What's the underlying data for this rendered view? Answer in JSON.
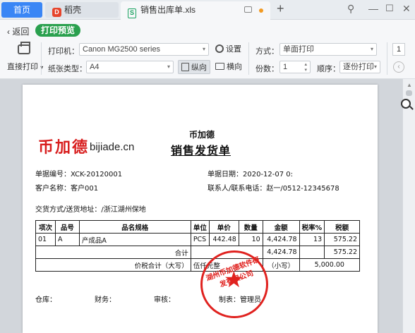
{
  "titlebar": {
    "tab_home": "首页",
    "tab_wps": "稻壳",
    "tab_file": "销售出库单.xls",
    "window_controls": [
      "minimize-icon",
      "maximize-icon",
      "close-icon"
    ]
  },
  "toolbar": {
    "back_label": "返回",
    "mode_label": "打印预览",
    "direct_print": "直接打印",
    "printer_label": "打印机：",
    "printer_value": "Canon MG2500 series",
    "settings_label": "设置",
    "paper_label": "纸张类型：",
    "paper_value": "A4",
    "portrait_label": "纵向",
    "landscape_label": "横向",
    "method_label": "方式：",
    "method_value": "单面打印",
    "copies_label": "份数：",
    "copies_value": "1",
    "order_label": "顺序：",
    "order_value": "逐份打印",
    "page_value": "1"
  },
  "document": {
    "logo_cn": "币加德",
    "logo_en": "bijiade.cn",
    "company": "币加德",
    "title": "销售发货单",
    "doc_no": "单据编号：XCK-20120001",
    "doc_date": "单据日期：2020-12-07 0:",
    "customer": "客户名称：客户001",
    "contact": "联系人/联系电话：赵一/0512-12345678",
    "address": "交货方式/送货地址：/浙江湖州保地",
    "table": {
      "headers": [
        "项次",
        "品号",
        "品名规格",
        "单位",
        "单价",
        "数量",
        "金额",
        "税率%",
        "税额"
      ],
      "rows": [
        [
          "01",
          "A",
          "产成品A",
          "PCS",
          "442.48",
          "10",
          "4,424.78",
          "13",
          "575.22"
        ]
      ],
      "subtotal_label": "合计",
      "subtotal_amount": "4,424.78",
      "subtotal_tax": "575.22",
      "total_label": "价税合计（大写）",
      "total_words": "伍仟元整",
      "total_small_label": "（小写）",
      "total_value": "5,000.00"
    },
    "footer": {
      "warehouse": "仓库：",
      "finance": "财务：",
      "audit": "审核：",
      "maker": "制表：",
      "maker_name": "管理员"
    },
    "stamp_text": "湖州币加德软件研发有限公司"
  }
}
